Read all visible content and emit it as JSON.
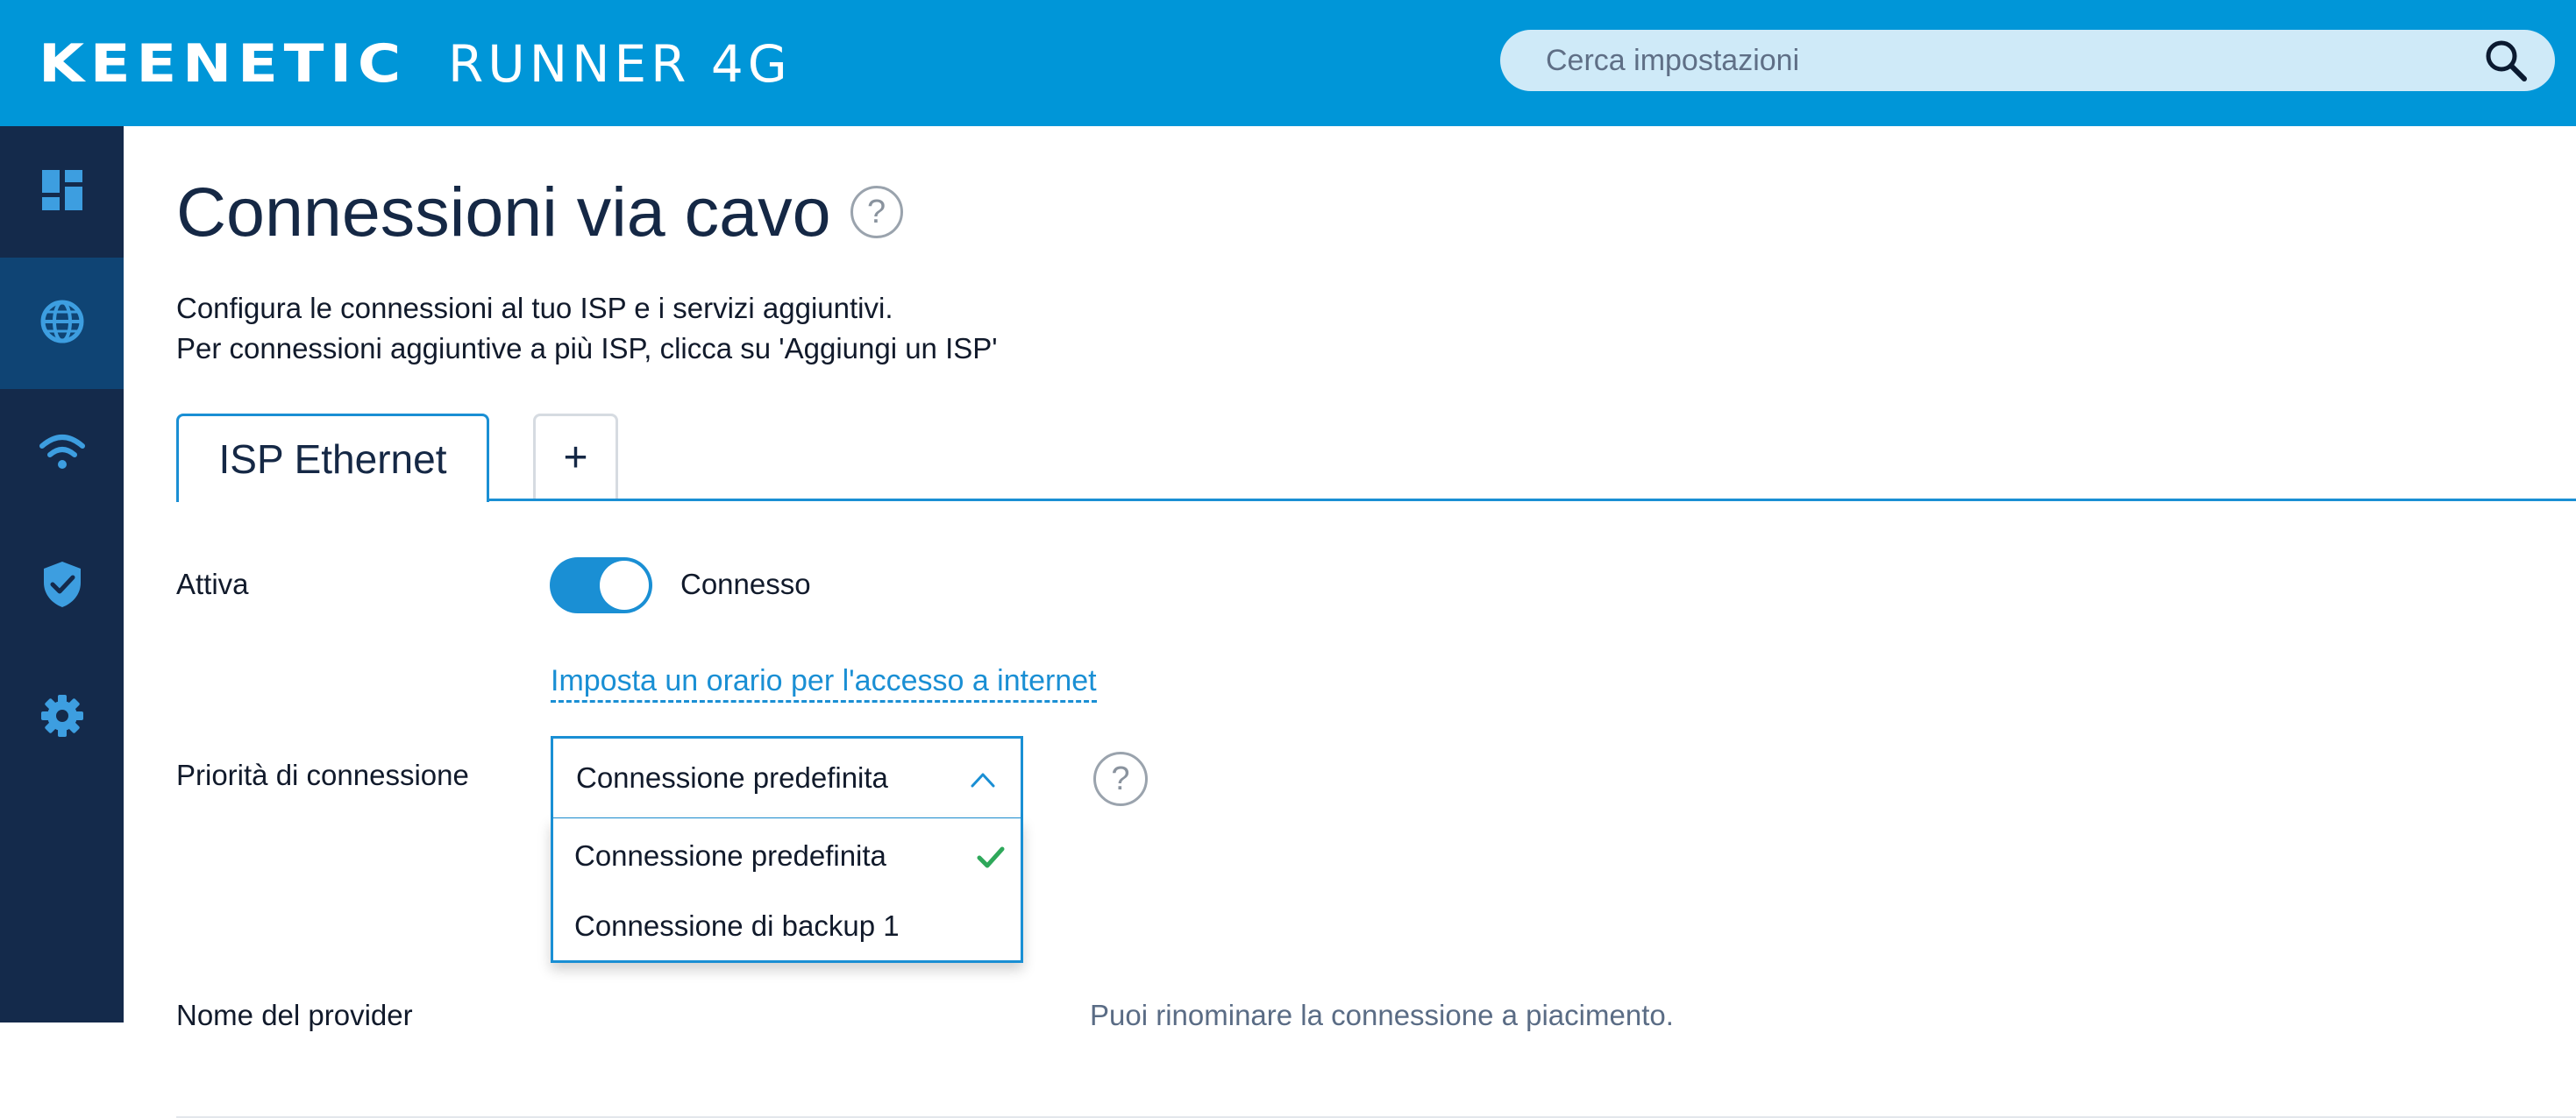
{
  "header": {
    "brand": "KEENETIC",
    "model": "RUNNER 4G",
    "search": {
      "placeholder": "Cerca impostazioni",
      "icon": "search-icon"
    }
  },
  "sidebar": {
    "items": [
      {
        "icon": "dashboard-icon",
        "active": false
      },
      {
        "icon": "globe-icon",
        "active": true
      },
      {
        "icon": "wifi-icon",
        "active": false
      },
      {
        "icon": "shield-icon",
        "active": false
      },
      {
        "icon": "gear-icon",
        "active": false
      }
    ]
  },
  "page": {
    "title": "Connessioni via cavo",
    "help_symbol": "?",
    "description_line1": "Configura le connessioni al tuo ISP e i servizi aggiuntivi.",
    "description_line2": "Per connessioni aggiuntive a più ISP, clicca su 'Aggiungi un ISP'"
  },
  "tabs": [
    {
      "label": "ISP Ethernet",
      "active": true
    },
    {
      "label": "+",
      "active": false
    }
  ],
  "form": {
    "active_label": "Attiva",
    "toggle_on": true,
    "status": "Connesso",
    "schedule_link": "Imposta un orario per l'accesso a internet",
    "priority_label": "Priorità di connessione",
    "priority_selected": "Connessione predefinita",
    "priority_options": [
      "Connessione predefinita",
      "Connessione di backup 1"
    ],
    "provider_label": "Nome del provider",
    "provider_hint": "Puoi rinominare la connessione a piacimento."
  },
  "colors": {
    "header_bg": "#0096d8",
    "sidebar_bg": "#142a4b",
    "sidebar_active_bg": "#0f4474",
    "accent": "#1a8fd4",
    "check": "#2ea85a"
  }
}
